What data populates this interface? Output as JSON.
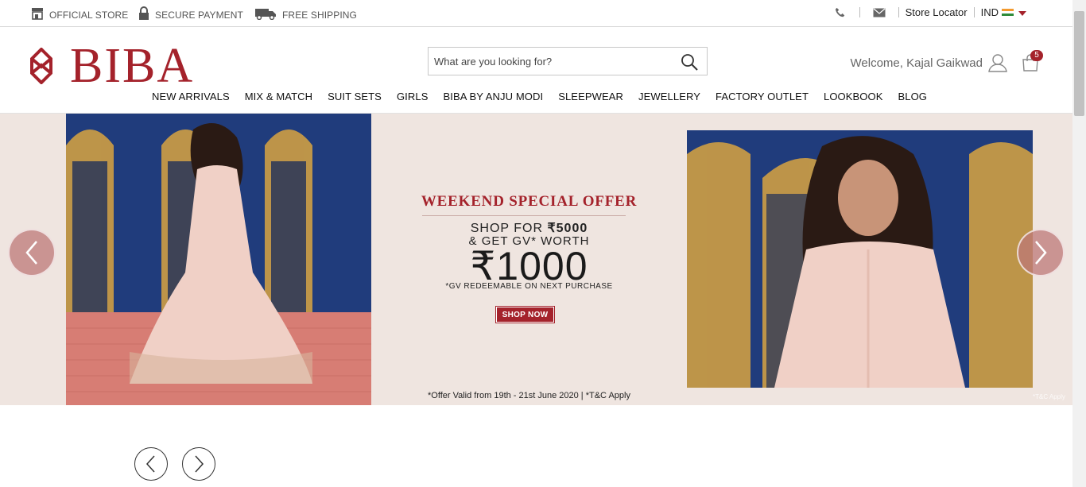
{
  "topbar": {
    "official_store": "OFFICIAL STORE",
    "secure_payment": "SECURE PAYMENT",
    "free_shipping": "FREE SHIPPING",
    "store_locator": "Store Locator",
    "currency": "IND"
  },
  "header": {
    "brand": "BIBA",
    "search_placeholder": "What are you looking for?",
    "welcome": "Welcome, Kajal Gaikwad",
    "cart_count": "5"
  },
  "nav": {
    "items": [
      "NEW ARRIVALS",
      "MIX & MATCH",
      "SUIT SETS",
      "GIRLS",
      "BIBA BY ANJU MODI",
      "SLEEPWEAR",
      "JEWELLERY",
      "FACTORY OUTLET",
      "LOOKBOOK",
      "BLOG"
    ]
  },
  "banner": {
    "title": "WEEKEND SPECIAL OFFER",
    "line1_prefix": "SHOP FOR ",
    "line1_amount": "₹5000",
    "line2": "& GET GV* WORTH",
    "big_amount": "₹1000",
    "note": "*GV REDEEMABLE ON NEXT PURCHASE",
    "cta": "SHOP NOW",
    "validity": "*Offer Valid from 19th - 21st June 2020 | *T&C Apply",
    "tc_small": "*T&C Apply"
  },
  "colors": {
    "brand": "#a4222b",
    "hero_bg": "#efe5e0",
    "royal_blue": "#1e3a78"
  }
}
